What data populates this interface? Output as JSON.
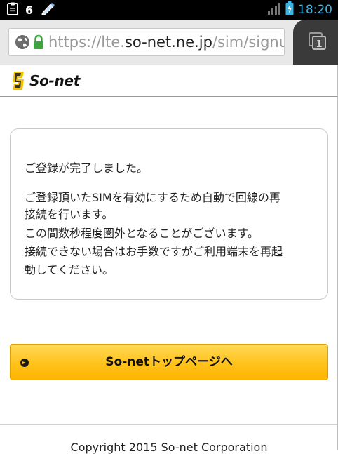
{
  "status_bar": {
    "notification_count": "6",
    "time": "18:20",
    "icons": [
      "clipboard-icon",
      "pen-icon",
      "signal-icon",
      "battery-charging-icon"
    ],
    "time_color": "#39b5e6"
  },
  "browser": {
    "url_prefix": "https://lte.",
    "url_domain": "so-net.ne.jp",
    "url_suffix": "/sim/signu",
    "tab_count": "1",
    "icons": [
      "globe-icon",
      "lock-icon",
      "tabs-icon"
    ]
  },
  "header": {
    "logo_text": "So-net"
  },
  "message": {
    "lines": [
      "ご登録が完了しました。",
      "ご登録頂いたSIMを有効にするため自動で回線の再",
      "接続を行います。",
      "この間数秒程度圏外となることがございます。",
      "接続できない場合はお手数ですがご利用端末を再起",
      "動してください。"
    ]
  },
  "button": {
    "label": "So-netトップページへ",
    "color": "#ffc21c"
  },
  "footer": {
    "copyright": "Copyright 2015 So-net Corporation"
  }
}
